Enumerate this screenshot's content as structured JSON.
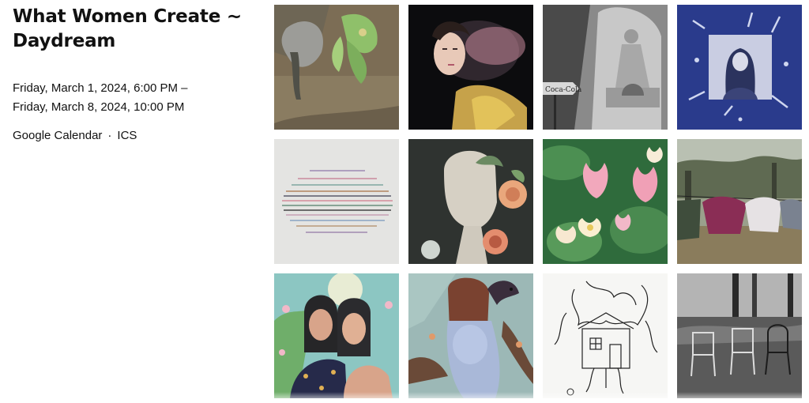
{
  "event": {
    "title_line1": "What Women Create ~",
    "title_line2": "Daydream",
    "date_start": "Friday, March 1, 2024, 6:00 PM –",
    "date_end": "Friday, March 8, 2024, 10:00 PM"
  },
  "links": {
    "google_calendar": "Google Calendar",
    "separator": "·",
    "ics": "ICS"
  },
  "artworks": {
    "street_sign_text": "Coca-Cola"
  }
}
